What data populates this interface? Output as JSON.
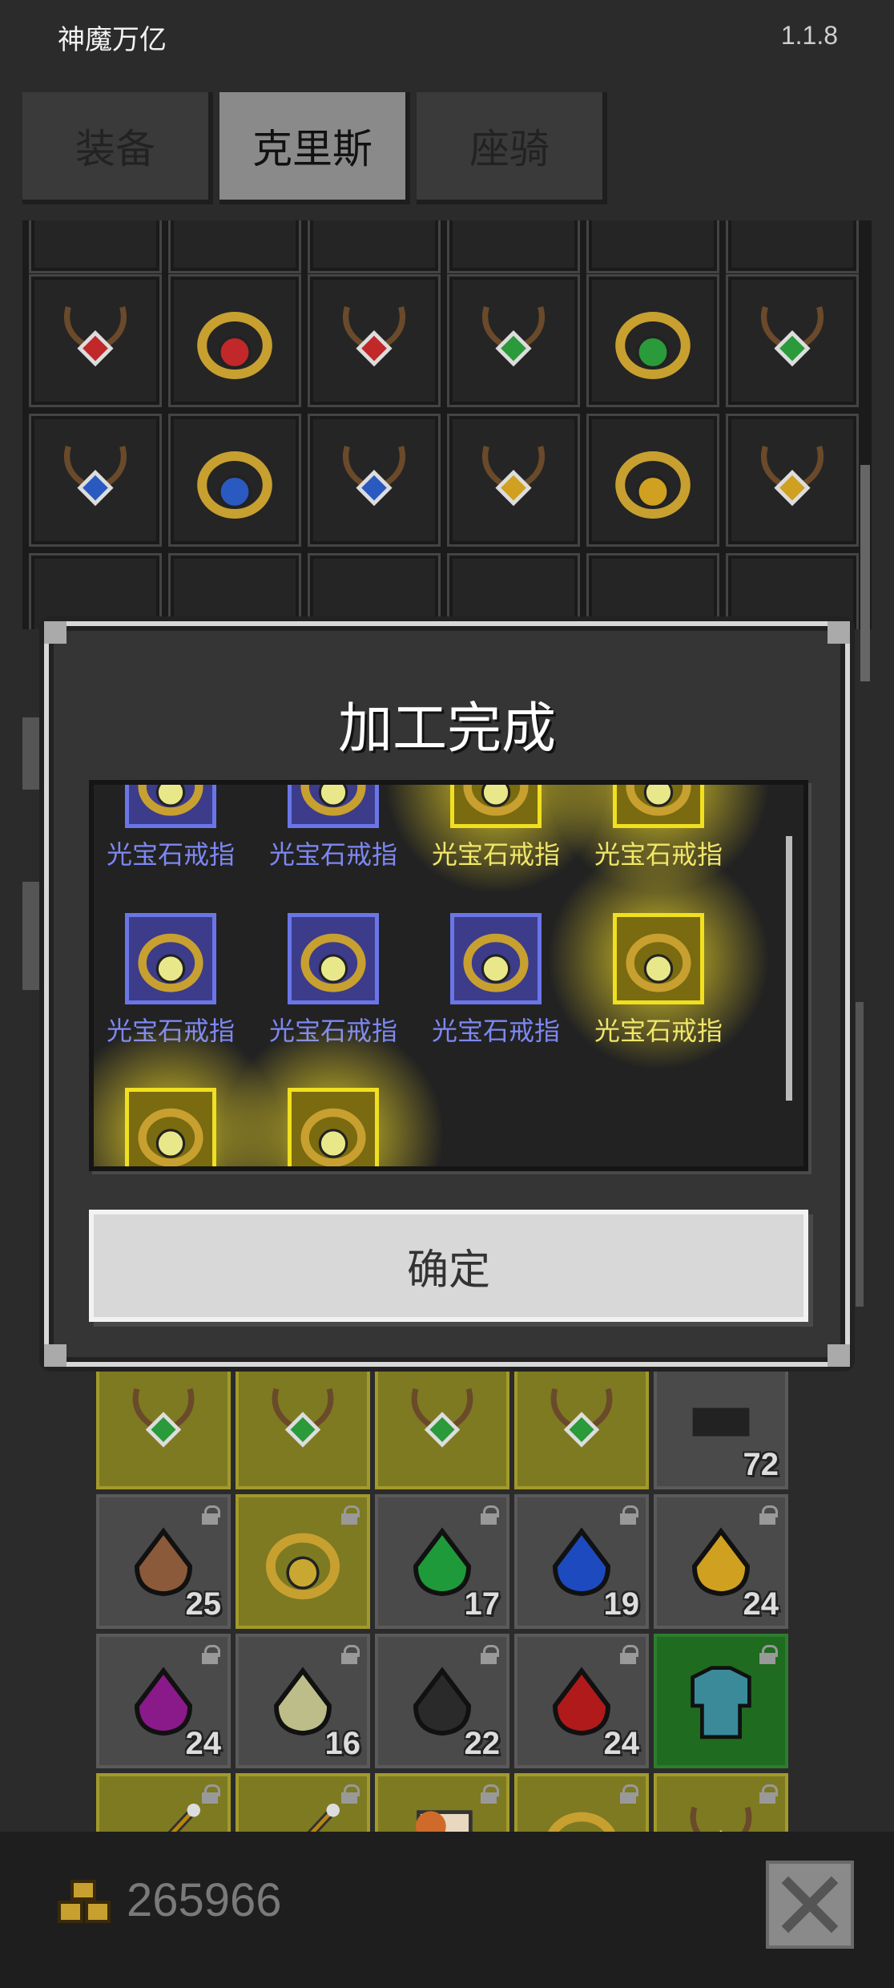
{
  "app": {
    "title": "神魔万亿",
    "version": "1.1.8"
  },
  "tabs": [
    {
      "label": "装备",
      "active": false
    },
    {
      "label": "克里斯",
      "active": true
    },
    {
      "label": "座骑",
      "active": false
    }
  ],
  "dialog": {
    "title": "加工完成",
    "confirm_label": "确定",
    "results": [
      {
        "name": "光宝石戒指",
        "rarity": "blue"
      },
      {
        "name": "光宝石戒指",
        "rarity": "blue"
      },
      {
        "name": "光宝石戒指",
        "rarity": "gold"
      },
      {
        "name": "光宝石戒指",
        "rarity": "gold"
      },
      {
        "name": "光宝石戒指",
        "rarity": "blue"
      },
      {
        "name": "光宝石戒指",
        "rarity": "blue"
      },
      {
        "name": "光宝石戒指",
        "rarity": "blue"
      },
      {
        "name": "光宝石戒指",
        "rarity": "gold"
      },
      {
        "name": "",
        "rarity": "gold"
      },
      {
        "name": "",
        "rarity": "gold"
      }
    ]
  },
  "inventory_top": [
    {
      "icon": "red-amulet-icon",
      "color": "#c0282a"
    },
    {
      "icon": "red-ring-icon",
      "color": "#c0282a"
    },
    {
      "icon": "red-brooch-icon",
      "color": "#c0282a"
    },
    {
      "icon": "green-amulet-icon",
      "color": "#2a9a3a"
    },
    {
      "icon": "green-ring-icon",
      "color": "#2a9a3a"
    },
    {
      "icon": "green-brooch-icon",
      "color": "#2a9a3a"
    },
    {
      "icon": "blue-amulet-icon",
      "color": "#2a5ac0"
    },
    {
      "icon": "blue-ring-icon",
      "color": "#2a5ac0"
    },
    {
      "icon": "blue-brooch-icon",
      "color": "#2a5ac0"
    },
    {
      "icon": "yellow-amulet-icon",
      "color": "#d0a020"
    },
    {
      "icon": "yellow-ring-icon",
      "color": "#d0a020"
    },
    {
      "icon": "yellow-brooch-icon",
      "color": "#d0a020"
    }
  ],
  "inventory_bottom": [
    {
      "icon": "green-amulet-icon",
      "bg": "gold",
      "count": "",
      "color": "#2a9a3a"
    },
    {
      "icon": "green-amulet-icon",
      "bg": "gold",
      "count": "",
      "color": "#2a9a3a"
    },
    {
      "icon": "green-amulet-icon",
      "bg": "gold",
      "count": "",
      "color": "#2a9a3a"
    },
    {
      "icon": "green-amulet-icon",
      "bg": "gold",
      "count": "",
      "color": "#2a9a3a"
    },
    {
      "icon": "dark-item-icon",
      "bg": "grey",
      "count": "72",
      "color": "#222"
    },
    {
      "icon": "brown-ore-icon",
      "bg": "grey",
      "count": "25",
      "color": "#8a5a3a"
    },
    {
      "icon": "gold-ring-icon",
      "bg": "gold",
      "count": "",
      "color": "#c8a830"
    },
    {
      "icon": "green-gem-icon",
      "bg": "grey",
      "count": "17",
      "color": "#1e9a3a"
    },
    {
      "icon": "blue-gem-icon",
      "bg": "grey",
      "count": "19",
      "color": "#1e4ac0"
    },
    {
      "icon": "yellow-gem-icon",
      "bg": "grey",
      "count": "24",
      "color": "#d0a020"
    },
    {
      "icon": "purple-gem-icon",
      "bg": "grey",
      "count": "24",
      "color": "#8a1a8a"
    },
    {
      "icon": "pale-gem-icon",
      "bg": "grey",
      "count": "16",
      "color": "#bdbd8a"
    },
    {
      "icon": "black-gem-icon",
      "bg": "grey",
      "count": "22",
      "color": "#2a2a2a"
    },
    {
      "icon": "red-gem-icon",
      "bg": "grey",
      "count": "24",
      "color": "#b01a1a"
    },
    {
      "icon": "blue-armor-icon",
      "bg": "green",
      "count": "",
      "color": "#3a8a9a"
    },
    {
      "icon": "spear-icon",
      "bg": "gold",
      "count": "",
      "color": "#bbb"
    },
    {
      "icon": "spear-icon",
      "bg": "gold",
      "count": "",
      "color": "#bbb"
    },
    {
      "icon": "scroll-icon",
      "bg": "gold",
      "count": "",
      "color": "#d06a2a"
    },
    {
      "icon": "blue-ring-icon",
      "bg": "gold",
      "count": "",
      "color": "#2a5ac0"
    },
    {
      "icon": "green-amulet-icon",
      "bg": "gold",
      "count": "",
      "color": "#2a9a3a"
    }
  ],
  "footer": {
    "gold_amount": "265966"
  }
}
